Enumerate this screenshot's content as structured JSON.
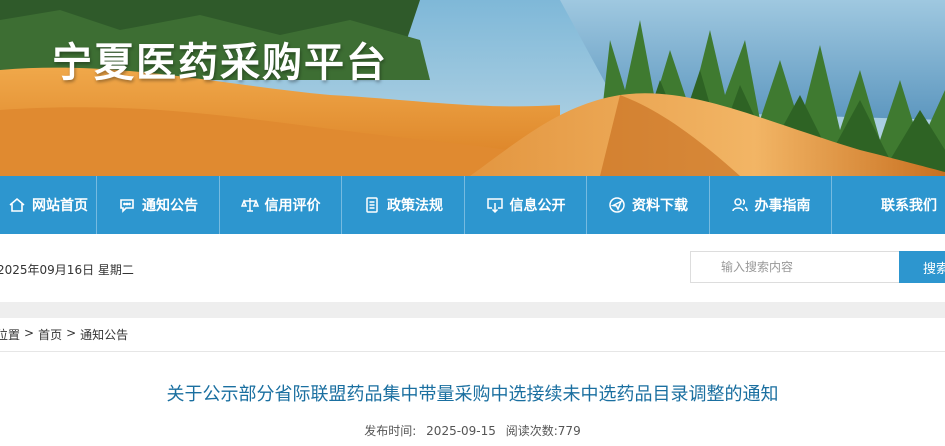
{
  "site": {
    "title": "宁夏医药采购平台"
  },
  "nav": {
    "items": [
      {
        "label": "网站首页",
        "icon": "home-icon"
      },
      {
        "label": "通知公告",
        "icon": "chat-icon"
      },
      {
        "label": "信用评价",
        "icon": "scale-icon"
      },
      {
        "label": "政策法规",
        "icon": "document-icon"
      },
      {
        "label": "信息公开",
        "icon": "monitor-download-icon"
      },
      {
        "label": "资料下载",
        "icon": "send-icon"
      },
      {
        "label": "办事指南",
        "icon": "users-icon"
      },
      {
        "label": "联系我们",
        "icon": ""
      }
    ]
  },
  "datebar": {
    "date": "2025年09月16日 星期二",
    "search_placeholder": "输入搜索内容",
    "search_button": "搜索"
  },
  "breadcrumb": {
    "prefix": "位置",
    "items": [
      "首页",
      "通知公告"
    ],
    "sep": ">"
  },
  "article": {
    "title": "关于公示部分省际联盟药品集中带量采购中选接续未中选药品目录调整的通知",
    "publish_label": "发布时间:",
    "publish_date": "2025-09-15",
    "views_label": "阅读次数:",
    "views": "779"
  },
  "colors": {
    "nav_bg": "#2d96cf",
    "title_link": "#1a6fa0"
  }
}
